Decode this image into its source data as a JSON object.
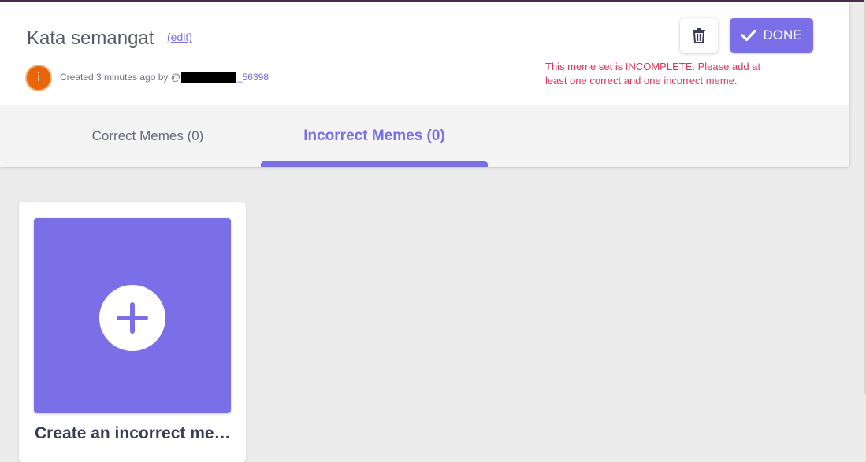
{
  "header": {
    "title": "Kata semangat",
    "edit_label": "(edit)",
    "avatar_letter": "i",
    "created_prefix": "Created 3 minutes ago by @",
    "username_suffix": "_56398",
    "done_label": "DONE",
    "warning": "This meme set is INCOMPLETE. Please add at least one correct and one incorrect meme."
  },
  "tabs": [
    {
      "label": "Correct Memes (0)",
      "active": false
    },
    {
      "label": "Incorrect Memes (0)",
      "active": true
    }
  ],
  "create_card": {
    "label": "Create an incorrect meme"
  },
  "icons": {
    "trash": "trash-icon",
    "done": "checkmark-icon",
    "add": "plus-icon"
  },
  "colors": {
    "accent": "#7b6fe8",
    "warning": "#e0335a",
    "avatar": "#e8650a"
  }
}
